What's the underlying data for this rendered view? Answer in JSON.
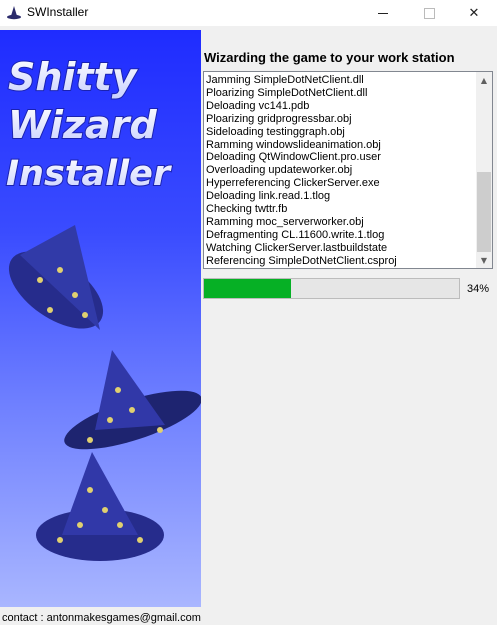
{
  "window": {
    "title": "SWInstaller",
    "minimize_icon": "minimize-icon",
    "maximize_icon": "maximize-icon",
    "close_icon": "close-icon",
    "close_glyph": "✕"
  },
  "banner": {
    "line1": "Shitty",
    "line2": "Wizard",
    "line3": "Installer",
    "colors": {
      "top": "#1f2cff",
      "bottom": "#a9b6ff",
      "hat": "#2a2f9a",
      "star": "#e0d070"
    }
  },
  "main": {
    "heading": "Wizarding the game to your work station",
    "log": [
      "Jamming SimpleDotNetClient.dll",
      "Ploarizing SimpleDotNetClient.dll",
      "Deloading vc141.pdb",
      "Ploarizing gridprogressbar.obj",
      "Sideloading testinggraph.obj",
      "Ramming windowslideanimation.obj",
      "Deloading QtWindowClient.pro.user",
      "Overloading updateworker.obj",
      "Hyperreferencing ClickerServer.exe",
      "Deloading link.read.1.tlog",
      "Checking twttr.fb",
      "Ramming moc_serverworker.obj",
      "Defragmenting CL.11600.write.1.tlog",
      "Watching ClickerServer.lastbuildstate",
      "Referencing SimpleDotNetClient.csproj"
    ],
    "scroll_up": "▲",
    "scroll_down": "▼",
    "progress": {
      "value": 0.34,
      "label": "34%",
      "color": "#06b025"
    }
  },
  "footer": {
    "contact": "contact : antonmakesgames@gmail.com"
  }
}
